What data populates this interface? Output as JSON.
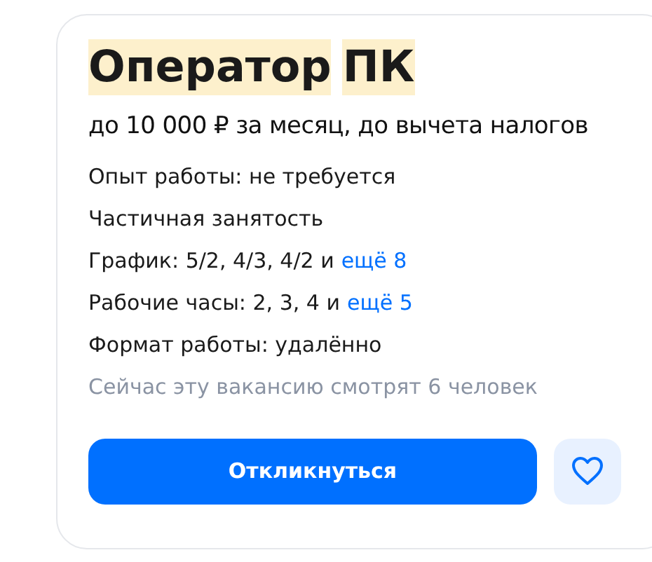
{
  "title_words": [
    {
      "text": "Оператор",
      "highlighted": true
    },
    {
      "text": "ПК",
      "highlighted": true
    }
  ],
  "salary": "до 10 000 ₽ за месяц, до вычета налогов",
  "details": [
    {
      "text": "Опыт работы: не требуется"
    },
    {
      "text": "Частичная занятость"
    },
    {
      "text": "График: 5/2, 4/3, 4/2 и",
      "link": "ещё 8"
    },
    {
      "text": "Рабочие часы: 2, 3, 4 и",
      "link": "ещё 5"
    },
    {
      "text": "Формат работы: удалённо"
    }
  ],
  "viewers": "Сейчас эту вакансию смотрят 6 человек",
  "apply_button": "Откликнуться",
  "favorite": {
    "selected": false
  }
}
